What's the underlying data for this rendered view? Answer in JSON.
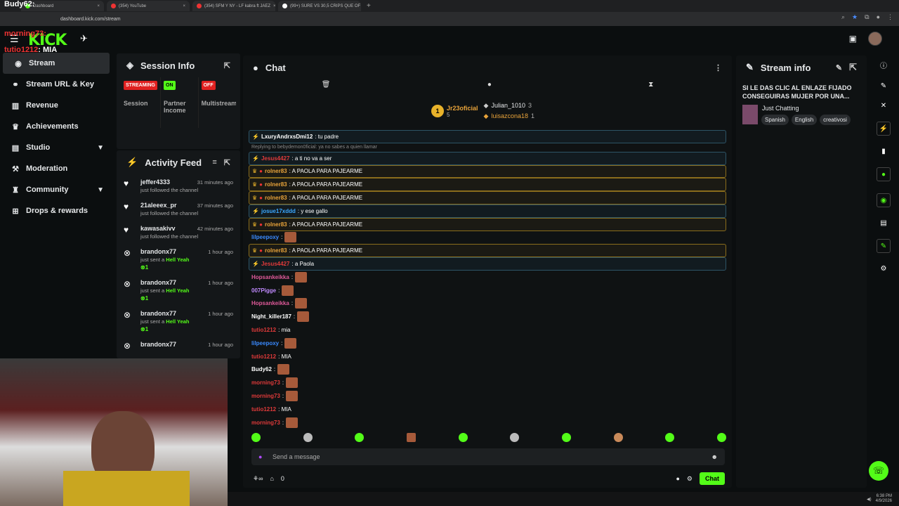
{
  "browser": {
    "tabs": [
      {
        "label": "Dashboard"
      },
      {
        "label": "(354) YouTube"
      },
      {
        "label": "(354) SFM Y NY - LF kabra ft JAEZ"
      },
      {
        "label": "(99+) SURE VS 30,5 CRIPS QUE OF"
      }
    ],
    "url": "dashboard.kick.com/stream",
    "clock": "6:38 PM",
    "date": "4/9/2026"
  },
  "overlay": {
    "lines": [
      {
        "user": "Budy62",
        "text": ":"
      },
      {
        "user": "morning73",
        "text": ":"
      },
      {
        "user": "tutio1212",
        "text": ": MIA"
      },
      {
        "user": "morning73",
        "text": ":"
      }
    ]
  },
  "app": {
    "logo": "KICK"
  },
  "sidebar": {
    "items": [
      {
        "label": "Stream",
        "icon": "broadcast-icon"
      },
      {
        "label": "Stream URL & Key",
        "icon": "link-icon"
      },
      {
        "label": "Revenue",
        "icon": "chart-icon"
      },
      {
        "label": "Achievements",
        "icon": "trophy-icon"
      },
      {
        "label": "Studio",
        "icon": "studio-icon"
      },
      {
        "label": "Moderation",
        "icon": "hammer-icon"
      },
      {
        "label": "Community",
        "icon": "community-icon"
      },
      {
        "label": "Drops & rewards",
        "icon": "gift-icon"
      }
    ]
  },
  "session": {
    "title": "Session Info",
    "cols": [
      {
        "badge": "STREAMING",
        "label": "Session",
        "color": "#e02020"
      },
      {
        "badge": "ON",
        "label": "Partner Income",
        "color": "#53fc18"
      },
      {
        "badge": "OFF",
        "label": "Multistream",
        "color": "#e02020"
      }
    ]
  },
  "activity": {
    "title": "Activity Feed",
    "items": [
      {
        "name": "jeffer4333",
        "sub": "just followed the channel",
        "time": "31 minutes ago",
        "gift": ""
      },
      {
        "name": "21aleeex_pr",
        "sub": "just followed the channel",
        "time": "37 minutes ago",
        "gift": ""
      },
      {
        "name": "kawasakivv",
        "sub": "just followed the channel",
        "time": "42 minutes ago",
        "gift": ""
      },
      {
        "name": "brandonx77",
        "sub": "just sent a",
        "time": "1 hour ago",
        "gift": "Hell Yeah"
      },
      {
        "name": "brandonx77",
        "sub": "just sent a",
        "time": "1 hour ago",
        "gift": "Hell Yeah"
      },
      {
        "name": "brandonx77",
        "sub": "just sent a",
        "time": "1 hour ago",
        "gift": "Hell Yeah"
      },
      {
        "name": "brandonx77",
        "sub": "",
        "time": "1 hour ago",
        "gift": ""
      }
    ]
  },
  "chat": {
    "title": "Chat",
    "leaders": [
      {
        "name": "Jr23oficial",
        "count": "5"
      },
      {
        "name": "Julian_1010",
        "count": "3"
      },
      {
        "name": "luisazcona18",
        "count": "1"
      }
    ],
    "messages": [
      {
        "user": "LxuryAndrxsDmi12",
        "text": ": tu padre",
        "style": "hlb",
        "color": "#ffffff"
      },
      {
        "user": "",
        "text": "Replying to bebydemon0ficial: ya no sabes a quien llamar",
        "style": "reply",
        "color": "#888888"
      },
      {
        "user": "Jesus4427",
        "text": ": a ti no va a ser",
        "style": "hlb",
        "color": "#e03a3a"
      },
      {
        "user": "rolner83",
        "text": ": A PAOLA PARA PAJEARME",
        "style": "hl",
        "color": "#e8a33a"
      },
      {
        "user": "rolner83",
        "text": ": A PAOLA PARA PAJEARME",
        "style": "hl",
        "color": "#e8a33a"
      },
      {
        "user": "rolner83",
        "text": ": A PAOLA PARA PAJEARME",
        "style": "hl",
        "color": "#e8a33a"
      },
      {
        "user": "josue17xddd",
        "text": ": y ese gallo",
        "style": "hlb",
        "color": "#3aa7ff"
      },
      {
        "user": "rolner83",
        "text": ": A PAOLA PARA PAJEARME",
        "style": "hl",
        "color": "#e8a33a"
      },
      {
        "user": "lilpeepoxy",
        "text": ":",
        "style": "",
        "color": "#3a8aff",
        "emote": true
      },
      {
        "user": "rolner83",
        "text": ": A PAOLA PARA PAJEARME",
        "style": "hl",
        "color": "#e8a33a"
      },
      {
        "user": "Jesus4427",
        "text": ": a Paola",
        "style": "hlb",
        "color": "#e03a3a"
      },
      {
        "user": "Hopsankeikka",
        "text": ":",
        "style": "",
        "color": "#e05a9a",
        "emote": true
      },
      {
        "user": "007Pigge",
        "text": ":",
        "style": "",
        "color": "#c08aff",
        "emote": true
      },
      {
        "user": "Hopsankeikka",
        "text": ":",
        "style": "",
        "color": "#e05a9a",
        "emote": true
      },
      {
        "user": "Night_killer187",
        "text": ":",
        "style": "",
        "color": "#ffffff",
        "emote": true
      },
      {
        "user": "tutio1212",
        "text": ": mia",
        "style": "",
        "color": "#e03a3a"
      },
      {
        "user": "lilpeepoxy",
        "text": ":",
        "style": "",
        "color": "#3a8aff",
        "emote": true
      },
      {
        "user": "tutio1212",
        "text": ": MIA",
        "style": "",
        "color": "#e03a3a"
      },
      {
        "user": "Budy62",
        "text": ":",
        "style": "",
        "color": "#ffffff",
        "emote": true
      },
      {
        "user": "morning73",
        "text": ":",
        "style": "",
        "color": "#e03a3a",
        "emote": true
      },
      {
        "user": "morning73",
        "text": ":",
        "style": "",
        "color": "#e03a3a",
        "emote": true
      },
      {
        "user": "tutio1212",
        "text": ": MIA",
        "style": "",
        "color": "#e03a3a"
      },
      {
        "user": "morning73",
        "text": ":",
        "style": "",
        "color": "#e03a3a",
        "emote": true
      }
    ],
    "send_placeholder": "Send a message",
    "points": "0",
    "chat_button": "Chat"
  },
  "streaminfo": {
    "title": "Stream info",
    "stream_title": "SI LE DAS CLIC AL ENLAZE FIJADO CONSEGUIRAS MUJER POR UNA...",
    "category": "Just Chatting",
    "tags": [
      "Spanish",
      "English",
      "creativosi"
    ]
  }
}
